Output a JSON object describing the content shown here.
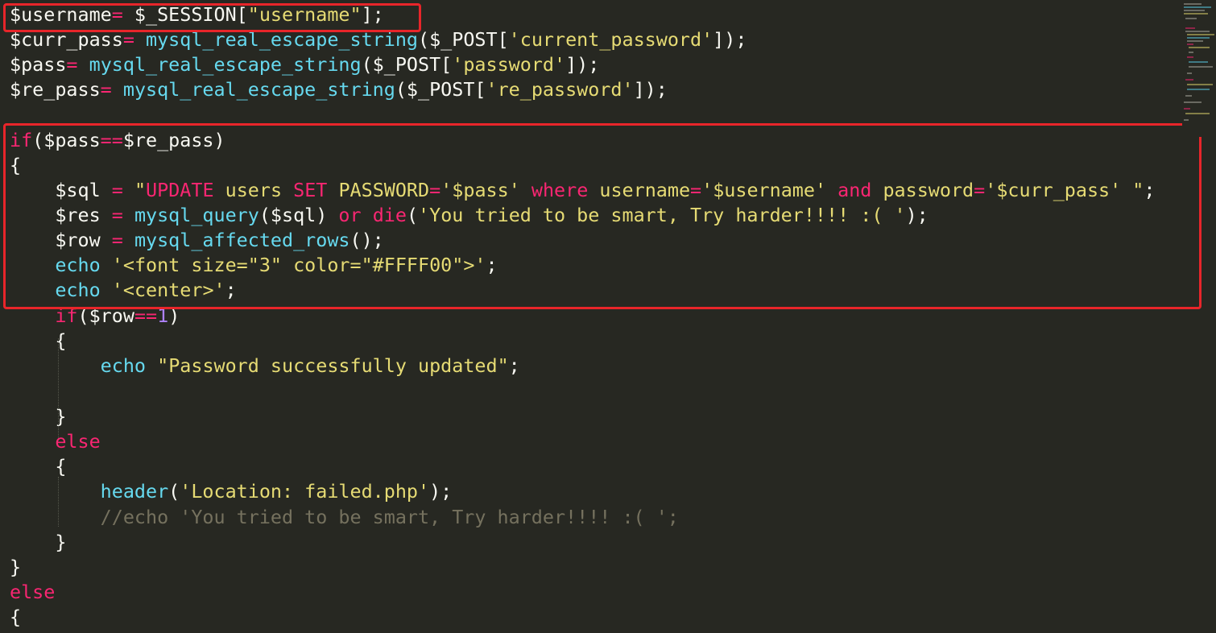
{
  "editor": {
    "theme_colors": {
      "background": "#272822",
      "plain": "#F8F8F2",
      "keyword": "#F92672",
      "function": "#66D9EF",
      "string": "#E6DB74",
      "number": "#AE81FF",
      "comment": "#75715E",
      "highlight_box": "#E8252A"
    },
    "lines": [
      [
        [
          "plain",
          "$username"
        ],
        [
          "op",
          "="
        ],
        [
          "plain",
          " $_SESSION["
        ],
        [
          "str",
          "\"username\""
        ],
        [
          "plain",
          "];"
        ]
      ],
      [
        [
          "plain",
          "$curr_pass"
        ],
        [
          "op",
          "="
        ],
        [
          "plain",
          " "
        ],
        [
          "fn",
          "mysql_real_escape_string"
        ],
        [
          "plain",
          "($_POST["
        ],
        [
          "str",
          "'current_password'"
        ],
        [
          "plain",
          "]);"
        ]
      ],
      [
        [
          "plain",
          "$pass"
        ],
        [
          "op",
          "="
        ],
        [
          "plain",
          " "
        ],
        [
          "fn",
          "mysql_real_escape_string"
        ],
        [
          "plain",
          "($_POST["
        ],
        [
          "str",
          "'password'"
        ],
        [
          "plain",
          "]);"
        ]
      ],
      [
        [
          "plain",
          "$re_pass"
        ],
        [
          "op",
          "="
        ],
        [
          "plain",
          " "
        ],
        [
          "fn",
          "mysql_real_escape_string"
        ],
        [
          "plain",
          "($_POST["
        ],
        [
          "str",
          "'re_password'"
        ],
        [
          "plain",
          "]);"
        ]
      ],
      [],
      [
        [
          "kw",
          "if"
        ],
        [
          "plain",
          "($pass"
        ],
        [
          "op",
          "=="
        ],
        [
          "plain",
          "$re_pass)"
        ]
      ],
      [
        [
          "plain",
          "{"
        ]
      ],
      [
        [
          "plain",
          "    $sql "
        ],
        [
          "op",
          "="
        ],
        [
          "plain",
          " "
        ],
        [
          "str",
          "\""
        ],
        [
          "kw",
          "UPDATE"
        ],
        [
          "str",
          " users "
        ],
        [
          "kw",
          "SET"
        ],
        [
          "str",
          " PASSWORD"
        ],
        [
          "op",
          "="
        ],
        [
          "str",
          "'$pass' "
        ],
        [
          "kw",
          "where"
        ],
        [
          "str",
          " username"
        ],
        [
          "op",
          "="
        ],
        [
          "str",
          "'$username' "
        ],
        [
          "kw",
          "and"
        ],
        [
          "str",
          " password"
        ],
        [
          "op",
          "="
        ],
        [
          "str",
          "'$curr_pass' \""
        ],
        [
          "plain",
          ";"
        ]
      ],
      [
        [
          "plain",
          "    $res "
        ],
        [
          "op",
          "="
        ],
        [
          "plain",
          " "
        ],
        [
          "fn",
          "mysql_query"
        ],
        [
          "plain",
          "($sql) "
        ],
        [
          "kw",
          "or"
        ],
        [
          "plain",
          " "
        ],
        [
          "kw",
          "die"
        ],
        [
          "plain",
          "("
        ],
        [
          "str",
          "'You tried to be smart, Try harder!!!! :( '"
        ],
        [
          "plain",
          ");"
        ]
      ],
      [
        [
          "plain",
          "    $row "
        ],
        [
          "op",
          "="
        ],
        [
          "plain",
          " "
        ],
        [
          "fn",
          "mysql_affected_rows"
        ],
        [
          "plain",
          "();"
        ]
      ],
      [
        [
          "plain",
          "    "
        ],
        [
          "fn",
          "echo"
        ],
        [
          "plain",
          " "
        ],
        [
          "str",
          "'<font size=\"3\" color=\"#FFFF00\">'"
        ],
        [
          "plain",
          ";"
        ]
      ],
      [
        [
          "plain",
          "    "
        ],
        [
          "fn",
          "echo"
        ],
        [
          "plain",
          " "
        ],
        [
          "str",
          "'<center>'"
        ],
        [
          "plain",
          ";"
        ]
      ],
      [
        [
          "plain",
          "    "
        ],
        [
          "kw",
          "if"
        ],
        [
          "plain",
          "($row"
        ],
        [
          "op",
          "=="
        ],
        [
          "num",
          "1"
        ],
        [
          "plain",
          ")"
        ]
      ],
      [
        [
          "plain",
          "    {"
        ]
      ],
      [
        [
          "plain",
          "        "
        ],
        [
          "fn",
          "echo"
        ],
        [
          "plain",
          " "
        ],
        [
          "str",
          "\"Password successfully updated\""
        ],
        [
          "plain",
          ";"
        ]
      ],
      [],
      [
        [
          "plain",
          "    }"
        ]
      ],
      [
        [
          "plain",
          "    "
        ],
        [
          "kw",
          "else"
        ]
      ],
      [
        [
          "plain",
          "    {"
        ]
      ],
      [
        [
          "plain",
          "        "
        ],
        [
          "fn",
          "header"
        ],
        [
          "plain",
          "("
        ],
        [
          "str",
          "'Location: failed.php'"
        ],
        [
          "plain",
          ");"
        ]
      ],
      [
        [
          "plain",
          "        "
        ],
        [
          "com",
          "//echo 'You tried to be smart, Try harder!!!! :( ';"
        ]
      ],
      [
        [
          "plain",
          "    }"
        ]
      ],
      [
        [
          "plain",
          "}"
        ]
      ],
      [
        [
          "kw",
          "else"
        ]
      ],
      [
        [
          "plain",
          "{"
        ]
      ]
    ]
  }
}
